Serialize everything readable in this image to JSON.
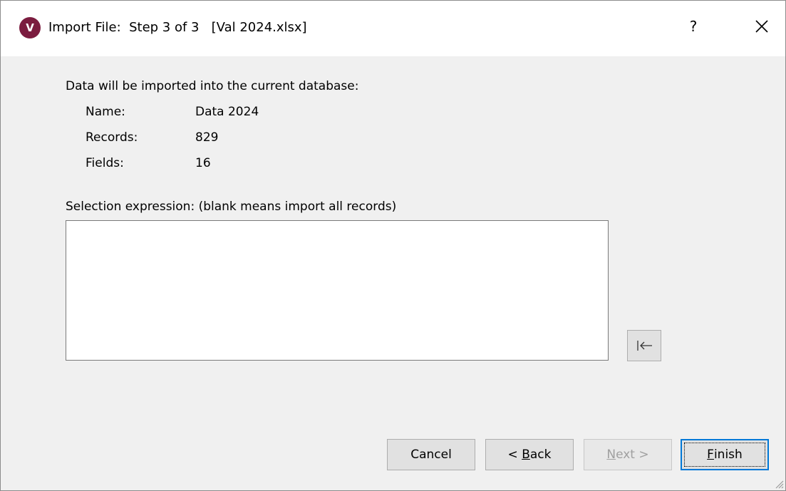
{
  "window": {
    "app_icon_letter": "V",
    "title": "Import File:  Step 3 of 3   [Val 2024.xlsx]",
    "help_label": "?",
    "close_icon": "close-icon"
  },
  "info": {
    "heading": "Data will be imported into the current database:",
    "rows": [
      {
        "label": "Name:",
        "value": "Data 2024"
      },
      {
        "label": "Records:",
        "value": "829"
      },
      {
        "label": "Fields:",
        "value": "16"
      }
    ]
  },
  "selection": {
    "label": "Selection expression: (blank means import all records)",
    "value": "",
    "insert_icon": "insert-field-icon"
  },
  "buttons": {
    "cancel": "Cancel",
    "back_prefix": "< ",
    "back_mnemonic": "B",
    "back_rest": "ack",
    "next_mnemonic": "N",
    "next_rest": "ext >",
    "finish_mnemonic": "F",
    "finish_rest": "inish"
  },
  "colors": {
    "accent": "#0078d7",
    "app_icon": "#7b1c3f",
    "dialog_bg": "#f0f0f0"
  }
}
